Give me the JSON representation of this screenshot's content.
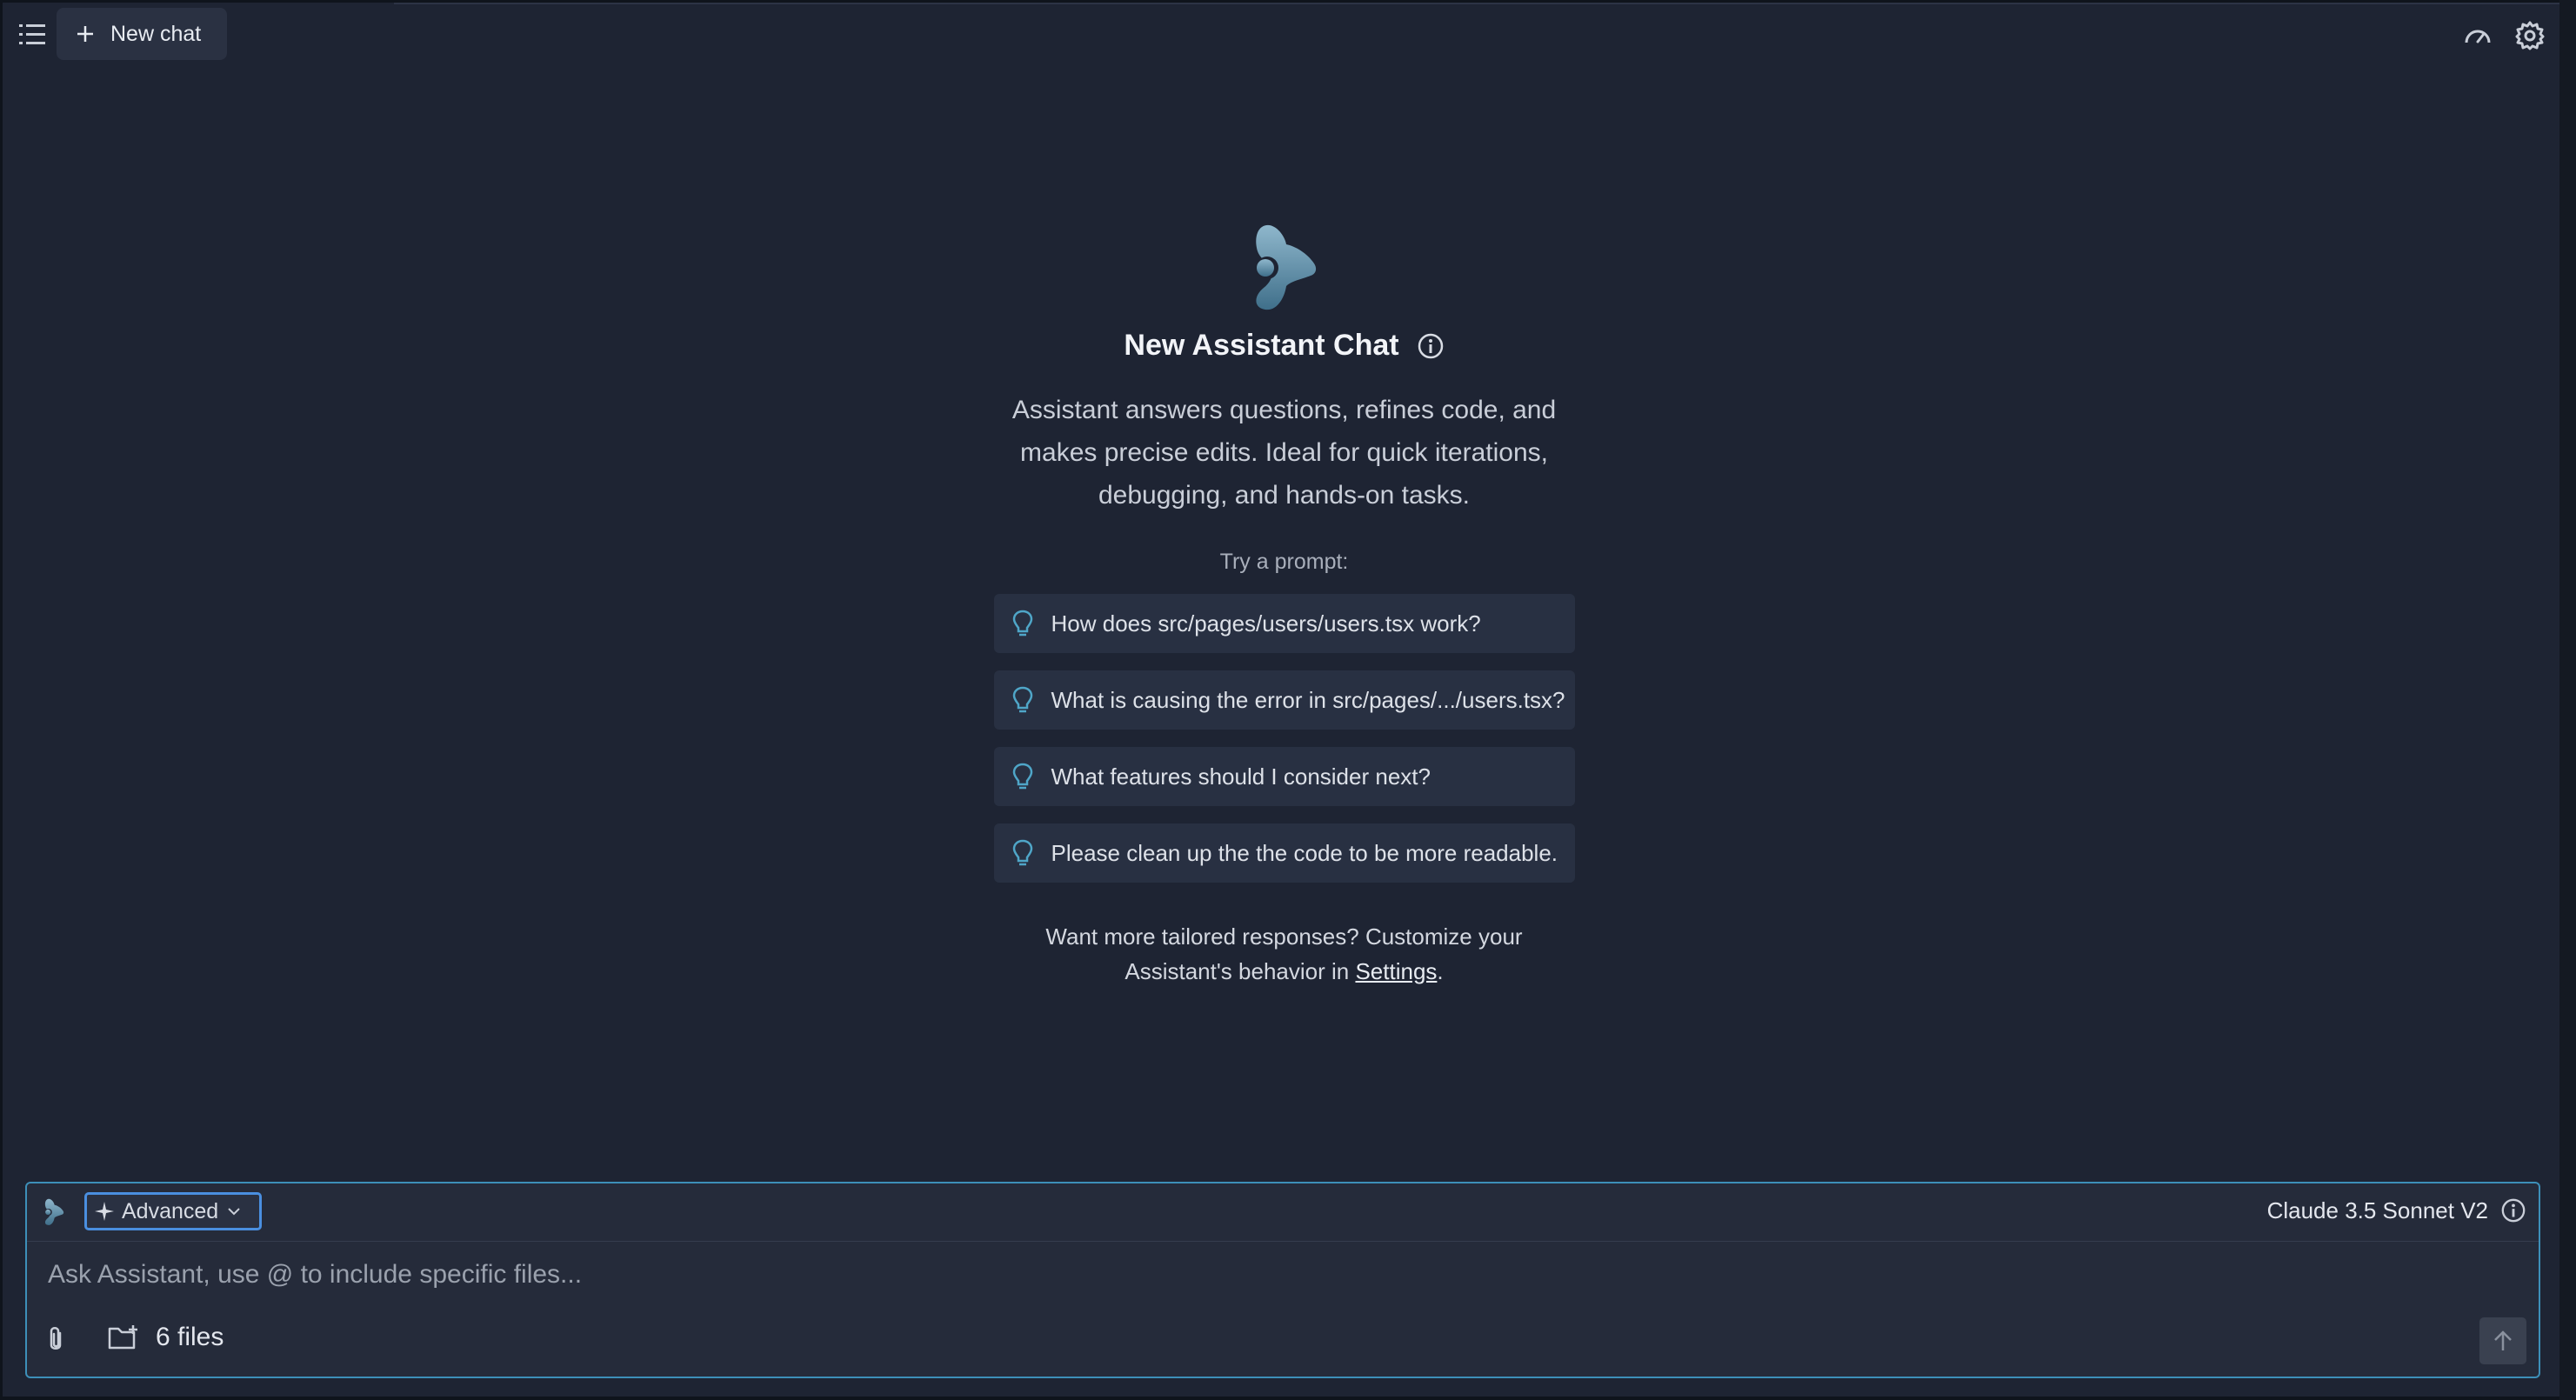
{
  "header": {
    "new_chat_label": "New chat",
    "menu_icon": "list-icon",
    "speed_icon": "gauge-icon",
    "settings_icon": "gear-icon"
  },
  "hero": {
    "title": "New Assistant Chat",
    "description": "Assistant answers questions, refines code, and makes precise edits. Ideal for quick iterations, debugging, and hands-on tasks.",
    "try_label": "Try a prompt:",
    "prompts": [
      {
        "label": "How does src/pages/users/users.tsx work?"
      },
      {
        "label": "What is causing the error in src/pages/.../users.tsx?"
      },
      {
        "label": "What features should I consider next?"
      },
      {
        "label": "Please clean up the the code to be more readable."
      }
    ],
    "note_prefix": "Want more tailored responses? Customize your Assistant's behavior in ",
    "note_link": "Settings",
    "note_suffix": "."
  },
  "composer": {
    "mode_label": "Advanced",
    "model_label": "Claude 3.5 Sonnet V2",
    "placeholder": "Ask Assistant, use @ to include specific files...",
    "value": "",
    "files_label": "6 files"
  },
  "colors": {
    "background": "#1e2433",
    "card": "#283042",
    "accent_border": "#3d8fb8",
    "mode_border": "#4a8fe0",
    "logo_gradient_top": "#8fb7cc",
    "logo_gradient_bottom": "#3f6f8a"
  }
}
